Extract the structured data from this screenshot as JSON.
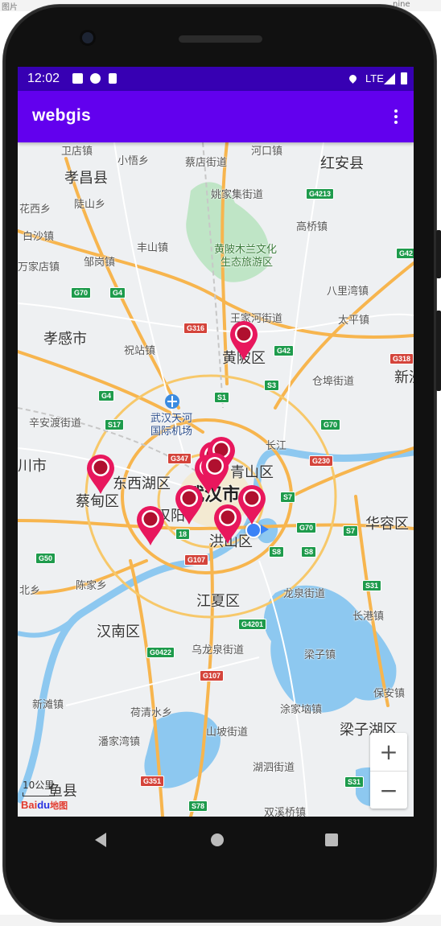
{
  "desktop": {
    "left_label": "图片",
    "right_label": "nine"
  },
  "statusbar": {
    "time": "12:02",
    "network": "LTE"
  },
  "appbar": {
    "title": "webgis",
    "menu_icon": "more-vert-icon"
  },
  "map": {
    "labels": [
      {
        "text": "卫店镇",
        "cls": "lbl"
      },
      {
        "text": "小悟乡",
        "cls": "lbl"
      },
      {
        "text": "蔡店街道",
        "cls": "lbl"
      },
      {
        "text": "河口镇",
        "cls": "lbl"
      },
      {
        "text": "红安县",
        "cls": "lbl big"
      },
      {
        "text": "孝昌县",
        "cls": "lbl big"
      },
      {
        "text": "姚家集街道",
        "cls": "lbl"
      },
      {
        "text": "陡山乡",
        "cls": "lbl"
      },
      {
        "text": "花西乡",
        "cls": "lbl"
      },
      {
        "text": "高桥镇",
        "cls": "lbl"
      },
      {
        "text": "白沙镇",
        "cls": "lbl"
      },
      {
        "text": "丰山镇",
        "cls": "lbl"
      },
      {
        "text": "黄陂木兰文化",
        "cls": "lbl green"
      },
      {
        "text": "生态旅游区",
        "cls": "lbl green"
      },
      {
        "text": "邹岗镇",
        "cls": "lbl"
      },
      {
        "text": "万家店镇",
        "cls": "lbl"
      },
      {
        "text": "八里湾镇",
        "cls": "lbl"
      },
      {
        "text": "王家河街道",
        "cls": "lbl"
      },
      {
        "text": "太平镇",
        "cls": "lbl"
      },
      {
        "text": "孝感市",
        "cls": "lbl big"
      },
      {
        "text": "祝站镇",
        "cls": "lbl"
      },
      {
        "text": "黄陂区",
        "cls": "lbl big"
      },
      {
        "text": "新洲",
        "cls": "lbl big"
      },
      {
        "text": "仓埠街道",
        "cls": "lbl"
      },
      {
        "text": "辛安渡街道",
        "cls": "lbl"
      },
      {
        "text": "武汉天河",
        "cls": "lbl blue"
      },
      {
        "text": "国际机场",
        "cls": "lbl blue"
      },
      {
        "text": "长江",
        "cls": "lbl"
      },
      {
        "text": "川市",
        "cls": "lbl big"
      },
      {
        "text": "东西湖区",
        "cls": "lbl big"
      },
      {
        "text": "青山区",
        "cls": "lbl big"
      },
      {
        "text": "蔡甸区",
        "cls": "lbl big"
      },
      {
        "text": "武汉市",
        "cls": "lbl city"
      },
      {
        "text": "汉阳",
        "cls": "lbl big"
      },
      {
        "text": "洪山区",
        "cls": "lbl big"
      },
      {
        "text": "华容区",
        "cls": "lbl big"
      },
      {
        "text": "陈家乡",
        "cls": "lbl"
      },
      {
        "text": "江夏区",
        "cls": "lbl big"
      },
      {
        "text": "龙泉街道",
        "cls": "lbl"
      },
      {
        "text": "北乡",
        "cls": "lbl"
      },
      {
        "text": "长港镇",
        "cls": "lbl"
      },
      {
        "text": "汉南区",
        "cls": "lbl big"
      },
      {
        "text": "乌龙泉街道",
        "cls": "lbl"
      },
      {
        "text": "梁子镇",
        "cls": "lbl"
      },
      {
        "text": "新滩镇",
        "cls": "lbl"
      },
      {
        "text": "保安镇",
        "cls": "lbl"
      },
      {
        "text": "荷清水乡",
        "cls": "lbl"
      },
      {
        "text": "涂家垴镇",
        "cls": "lbl"
      },
      {
        "text": "梁子湖区",
        "cls": "lbl big"
      },
      {
        "text": "潘家湾镇",
        "cls": "lbl"
      },
      {
        "text": "山坡街道",
        "cls": "lbl"
      },
      {
        "text": "湖泗街道",
        "cls": "lbl"
      },
      {
        "text": "鱼县",
        "cls": "lbl big"
      },
      {
        "text": "双溪桥镇",
        "cls": "lbl"
      }
    ],
    "shields": [
      {
        "text": "G4213",
        "cls": "shield g"
      },
      {
        "text": "G42",
        "cls": "shield g"
      },
      {
        "text": "G70",
        "cls": "shield g"
      },
      {
        "text": "G4",
        "cls": "shield g"
      },
      {
        "text": "G316",
        "cls": "shield r"
      },
      {
        "text": "G42",
        "cls": "shield g"
      },
      {
        "text": "G318",
        "cls": "shield r"
      },
      {
        "text": "S3",
        "cls": "shield g"
      },
      {
        "text": "G4",
        "cls": "shield g"
      },
      {
        "text": "S1",
        "cls": "shield g"
      },
      {
        "text": "S17",
        "cls": "shield g"
      },
      {
        "text": "G70",
        "cls": "shield g"
      },
      {
        "text": "G347",
        "cls": "shield r"
      },
      {
        "text": "G230",
        "cls": "shield r"
      },
      {
        "text": "S7",
        "cls": "shield g"
      },
      {
        "text": "G70",
        "cls": "shield g"
      },
      {
        "text": "S7",
        "cls": "shield g"
      },
      {
        "text": "G50",
        "cls": "shield g"
      },
      {
        "text": "S8",
        "cls": "shield g"
      },
      {
        "text": "G107",
        "cls": "shield r"
      },
      {
        "text": "G4201",
        "cls": "shield g"
      },
      {
        "text": "S31",
        "cls": "shield g"
      },
      {
        "text": "G0422",
        "cls": "shield g"
      },
      {
        "text": "G107",
        "cls": "shield r"
      },
      {
        "text": "G351",
        "cls": "shield r"
      },
      {
        "text": "S78",
        "cls": "shield g"
      },
      {
        "text": "S31",
        "cls": "shield g"
      },
      {
        "text": "18",
        "cls": "shield g"
      },
      {
        "text": "S8",
        "cls": "shield g"
      }
    ],
    "marker_count": 10,
    "scale": "10公里",
    "attribution": {
      "brand": "Bai",
      "brand_blue": "du",
      "suffix": "地图"
    },
    "zoom": {
      "in": "+",
      "out": "−"
    }
  },
  "colors": {
    "statusbar": "#3700b3",
    "appbar": "#6200ee",
    "marker": "#e8175d",
    "marker_center": "#b0102f"
  }
}
